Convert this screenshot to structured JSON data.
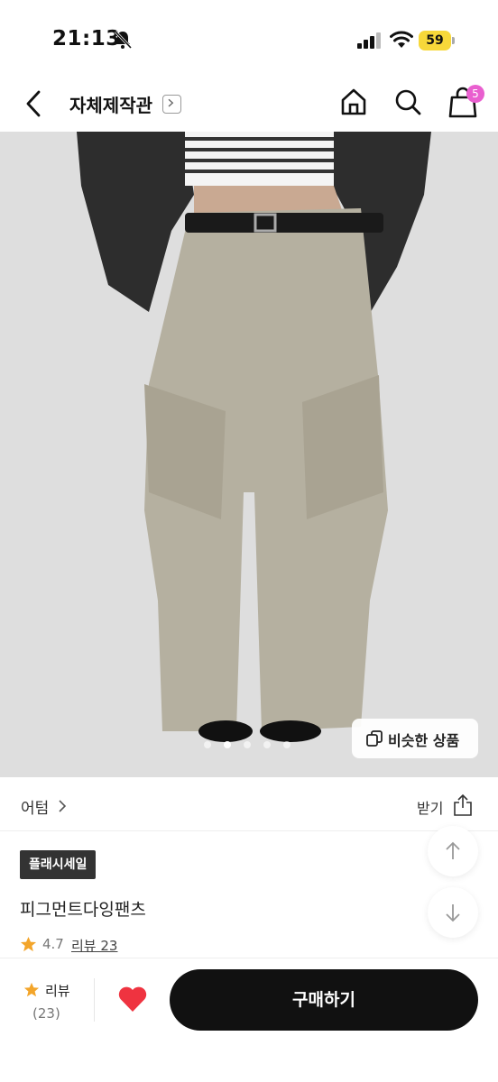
{
  "status_bar": {
    "time": "21:13",
    "battery": "59"
  },
  "header": {
    "title": "자체제작관",
    "cart_count": "5"
  },
  "product_image": {
    "similar_label": "비슷한 상품",
    "slide_count": 5,
    "active_slide": 2
  },
  "brand": {
    "name": "어텀",
    "coupon_label": "받기"
  },
  "product": {
    "badge": "플래시세일",
    "name": "피그먼트다잉팬츠",
    "rating": "4.7",
    "review_link": "리뷰 23"
  },
  "bottom_bar": {
    "review_label": "리뷰",
    "review_count": "(23)",
    "buy_label": "구매하기",
    "heart_color": "#ef3340"
  },
  "colors": {
    "accent_badge": "#e95fcf",
    "star": "#f3a52a",
    "battery": "#f7d83a"
  }
}
